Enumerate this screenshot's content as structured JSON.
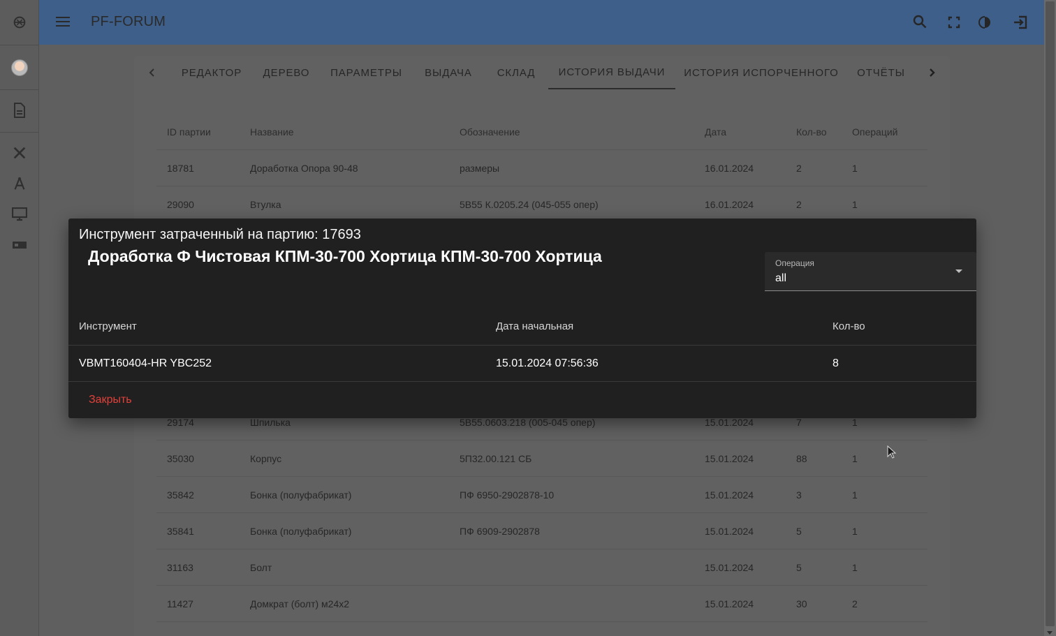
{
  "app": {
    "title": "PF-FORUM"
  },
  "sidebar": {
    "items": [
      {
        "name": "logo-icon"
      },
      {
        "name": "user-avatar"
      },
      {
        "name": "document-icon"
      },
      {
        "name": "tools-icon"
      },
      {
        "name": "compass-icon"
      },
      {
        "name": "monitor-icon"
      },
      {
        "name": "card-icon"
      }
    ]
  },
  "topbar": {
    "icons": [
      "search-icon",
      "fullscreen-icon",
      "theme-toggle-icon",
      "logout-icon"
    ]
  },
  "tabs": [
    {
      "label": "РЕДАКТОР",
      "active": false
    },
    {
      "label": "ДЕРЕВО",
      "active": false
    },
    {
      "label": "ПАРАМЕТРЫ",
      "active": false
    },
    {
      "label": "ВЫДАЧА",
      "active": false
    },
    {
      "label": "СКЛАД",
      "active": false
    },
    {
      "label": "ИСТОРИЯ ВЫДАЧИ",
      "active": true
    },
    {
      "label": "ИСТОРИЯ ИСПОРЧЕННОГО",
      "active": false
    },
    {
      "label": "ОТЧЁТЫ",
      "active": false
    }
  ],
  "table": {
    "columns": [
      "ID партии",
      "Название",
      "Обозначение",
      "Дата",
      "Кол-во",
      "Операций"
    ],
    "rows_top": [
      [
        "18781",
        "Доработка Опора 90-48",
        "размеры",
        "16.01.2024",
        "2",
        "1"
      ],
      [
        "29090",
        "Втулка",
        "5В55 К.0205.24 (045-055 опер)",
        "16.01.2024",
        "2",
        "1"
      ]
    ],
    "rows_bottom": [
      [
        "29174",
        "Шпилька",
        "5В55.0603.218 (005-045 опер)",
        "15.01.2024",
        "7",
        "1"
      ],
      [
        "35030",
        "Корпус",
        "5П32.00.121 СБ",
        "15.01.2024",
        "88",
        "1"
      ],
      [
        "35842",
        "Бонка (полуфабрикат)",
        "ПФ 6950-2902878-10",
        "15.01.2024",
        "3",
        "1"
      ],
      [
        "35841",
        "Бонка (полуфабрикат)",
        "ПФ 6909-2902878",
        "15.01.2024",
        "5",
        "1"
      ],
      [
        "31163",
        "Болт",
        "",
        "15.01.2024",
        "5",
        "1"
      ],
      [
        "11427",
        "Домкрат (болт) м24х2",
        "",
        "15.01.2024",
        "30",
        "2"
      ]
    ]
  },
  "dialog": {
    "title": "Инструмент затраченный на партию: 17693",
    "subtitle": "Доработка Ф Чистовая КПМ-30-700 Хортица КПМ-30-700 Хортица",
    "operation_label": "Операция",
    "operation_value": "all",
    "columns": [
      "Инструмент",
      "Дата начальная",
      "Кол-во"
    ],
    "rows": [
      [
        "VBMT160404-HR YBC252",
        "15.01.2024 07:56:36",
        "8"
      ]
    ],
    "close_label": "Закрыть"
  },
  "colors": {
    "topbar": "#3d5f8a",
    "dialog_bg": "#202020",
    "close_button": "#e0413a"
  }
}
